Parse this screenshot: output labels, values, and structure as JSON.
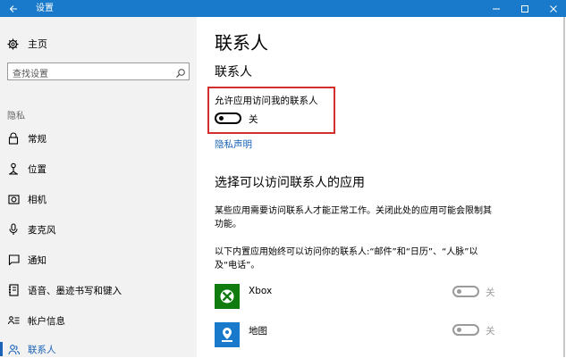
{
  "window": {
    "title": "设置",
    "accent_color": "#1979ca"
  },
  "sidebar": {
    "home_label": "主页",
    "search_placeholder": "查找设置",
    "section_label": "隐私",
    "items": [
      {
        "label": "常规",
        "icon": "lock-icon"
      },
      {
        "label": "位置",
        "icon": "location-icon"
      },
      {
        "label": "相机",
        "icon": "camera-icon"
      },
      {
        "label": "麦克风",
        "icon": "microphone-icon"
      },
      {
        "label": "通知",
        "icon": "notification-icon"
      },
      {
        "label": "语音、墨迹书写和键入",
        "icon": "notebook-icon"
      },
      {
        "label": "帐户信息",
        "icon": "account-info-icon"
      },
      {
        "label": "联系人",
        "icon": "contacts-icon",
        "active": true
      }
    ]
  },
  "main": {
    "page_title": "联系人",
    "subtitle": "联系人",
    "allow_label": "允许应用访问我的联系人",
    "allow_toggle": {
      "state_label": "关",
      "on": false
    },
    "privacy_link": "隐私声明",
    "apps_section_title": "选择可以访问联系人的应用",
    "description_1": "某些应用需要访问联系人才能正常工作。关闭此处的应用可能会限制其功能。",
    "description_2": "以下内置应用始终可以访问你的联系人:“邮件”和“日历”、“人脉”以及“电话”。",
    "apps": [
      {
        "name": "Xbox",
        "icon": "xbox-icon",
        "state_label": "关",
        "color": "#107c10"
      },
      {
        "name": "地图",
        "icon": "maps-icon",
        "state_label": "关",
        "color": "#1979ca"
      }
    ]
  }
}
